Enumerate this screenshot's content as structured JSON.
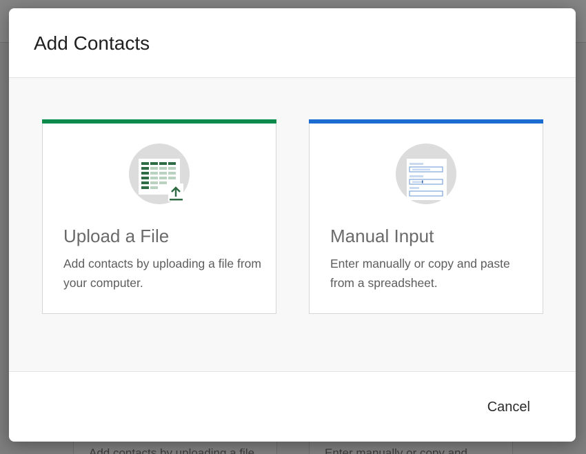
{
  "modal": {
    "title": "Add Contacts",
    "cancel_label": "Cancel"
  },
  "options": [
    {
      "title": "Upload a File",
      "description": "Add contacts by uploading a file from your computer.",
      "accent_color": "#0b8a4c",
      "icon": "spreadsheet-upload-icon"
    },
    {
      "title": "Manual Input",
      "description": "Enter manually or copy and paste from a spreadsheet.",
      "accent_color": "#1a6cd0",
      "icon": "manual-form-icon"
    }
  ],
  "background_page": {
    "card_texts": [
      "Add contacts by uploading a file",
      "Enter manually or copy and"
    ]
  }
}
